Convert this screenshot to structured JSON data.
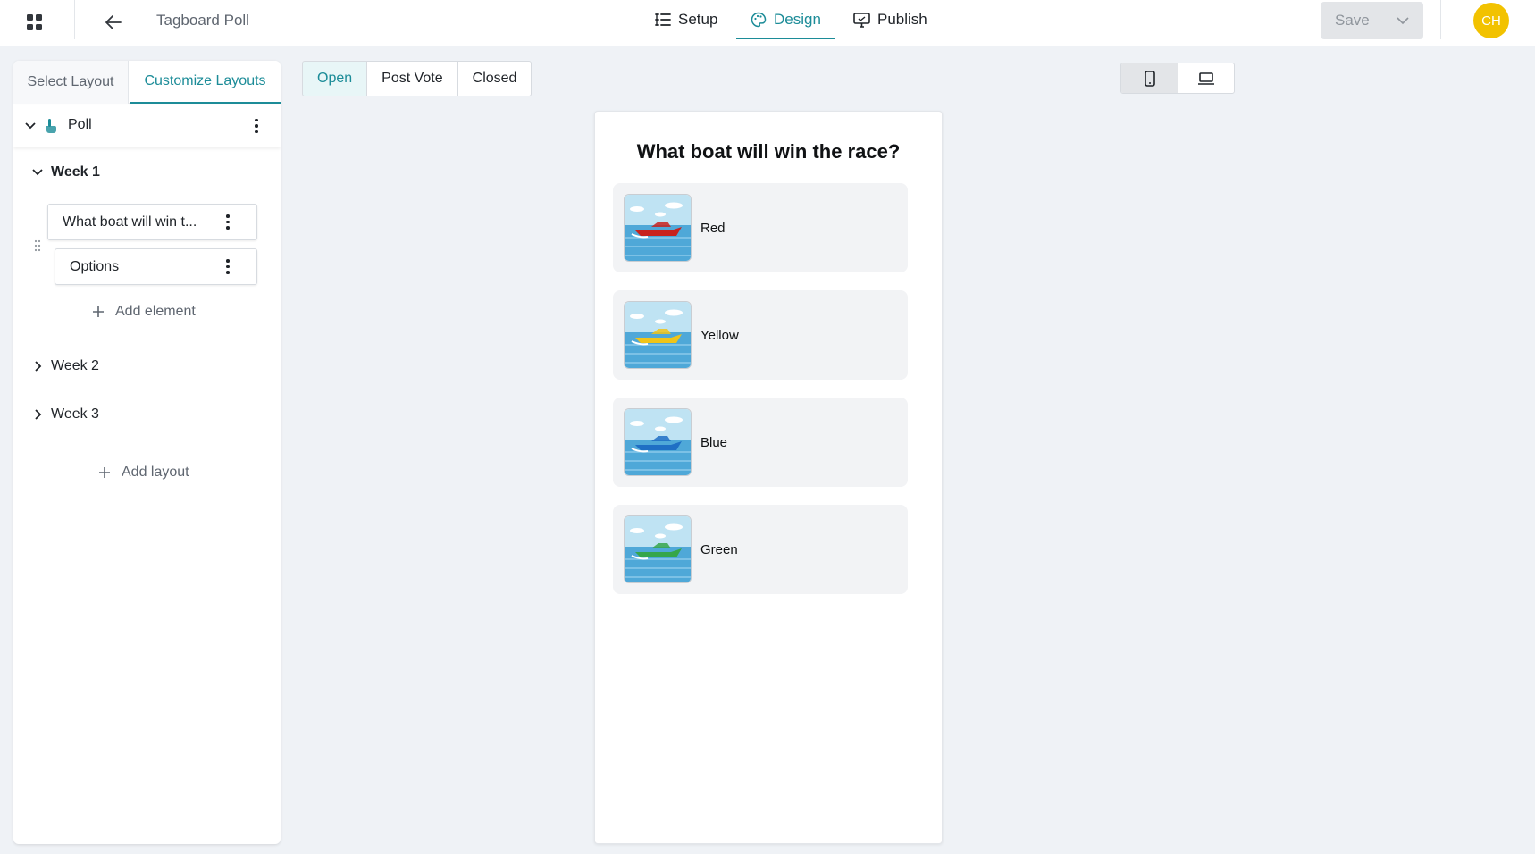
{
  "header": {
    "app_title": "Tagboard Poll",
    "nav": [
      {
        "label": "Setup",
        "icon": "setup-list-icon"
      },
      {
        "label": "Design",
        "icon": "palette-icon",
        "active": true
      },
      {
        "label": "Publish",
        "icon": "monitor-icon"
      }
    ],
    "save_label": "Save",
    "avatar_initials": "CH",
    "avatar_color": "#f2c200",
    "accent_color": "#1c8c98"
  },
  "left_panel": {
    "tabs": [
      {
        "label": "Select Layout",
        "active": false
      },
      {
        "label": "Customize Layouts",
        "active": true
      }
    ],
    "poll_label": "Poll",
    "weeks": [
      {
        "label": "Week 1",
        "expanded": true
      },
      {
        "label": "Week 2",
        "expanded": false
      },
      {
        "label": "Week 3",
        "expanded": false
      }
    ],
    "elements": [
      {
        "label": "What boat will win t..."
      },
      {
        "label": "Options"
      }
    ],
    "add_element_label": "Add element",
    "add_layout_label": "Add layout"
  },
  "state_tabs": [
    {
      "label": "Open",
      "active": true
    },
    {
      "label": "Post Vote",
      "active": false
    },
    {
      "label": "Closed",
      "active": false
    }
  ],
  "device_toggle": {
    "options": [
      "mobile-icon",
      "laptop-icon"
    ],
    "active": "mobile-icon"
  },
  "preview": {
    "question": "What boat will win the race?",
    "options": [
      {
        "label": "Red",
        "boat_color": "#c8221d"
      },
      {
        "label": "Yellow",
        "boat_color": "#f0c419"
      },
      {
        "label": "Blue",
        "boat_color": "#1f6fc4"
      },
      {
        "label": "Green",
        "boat_color": "#35a64a"
      }
    ]
  }
}
